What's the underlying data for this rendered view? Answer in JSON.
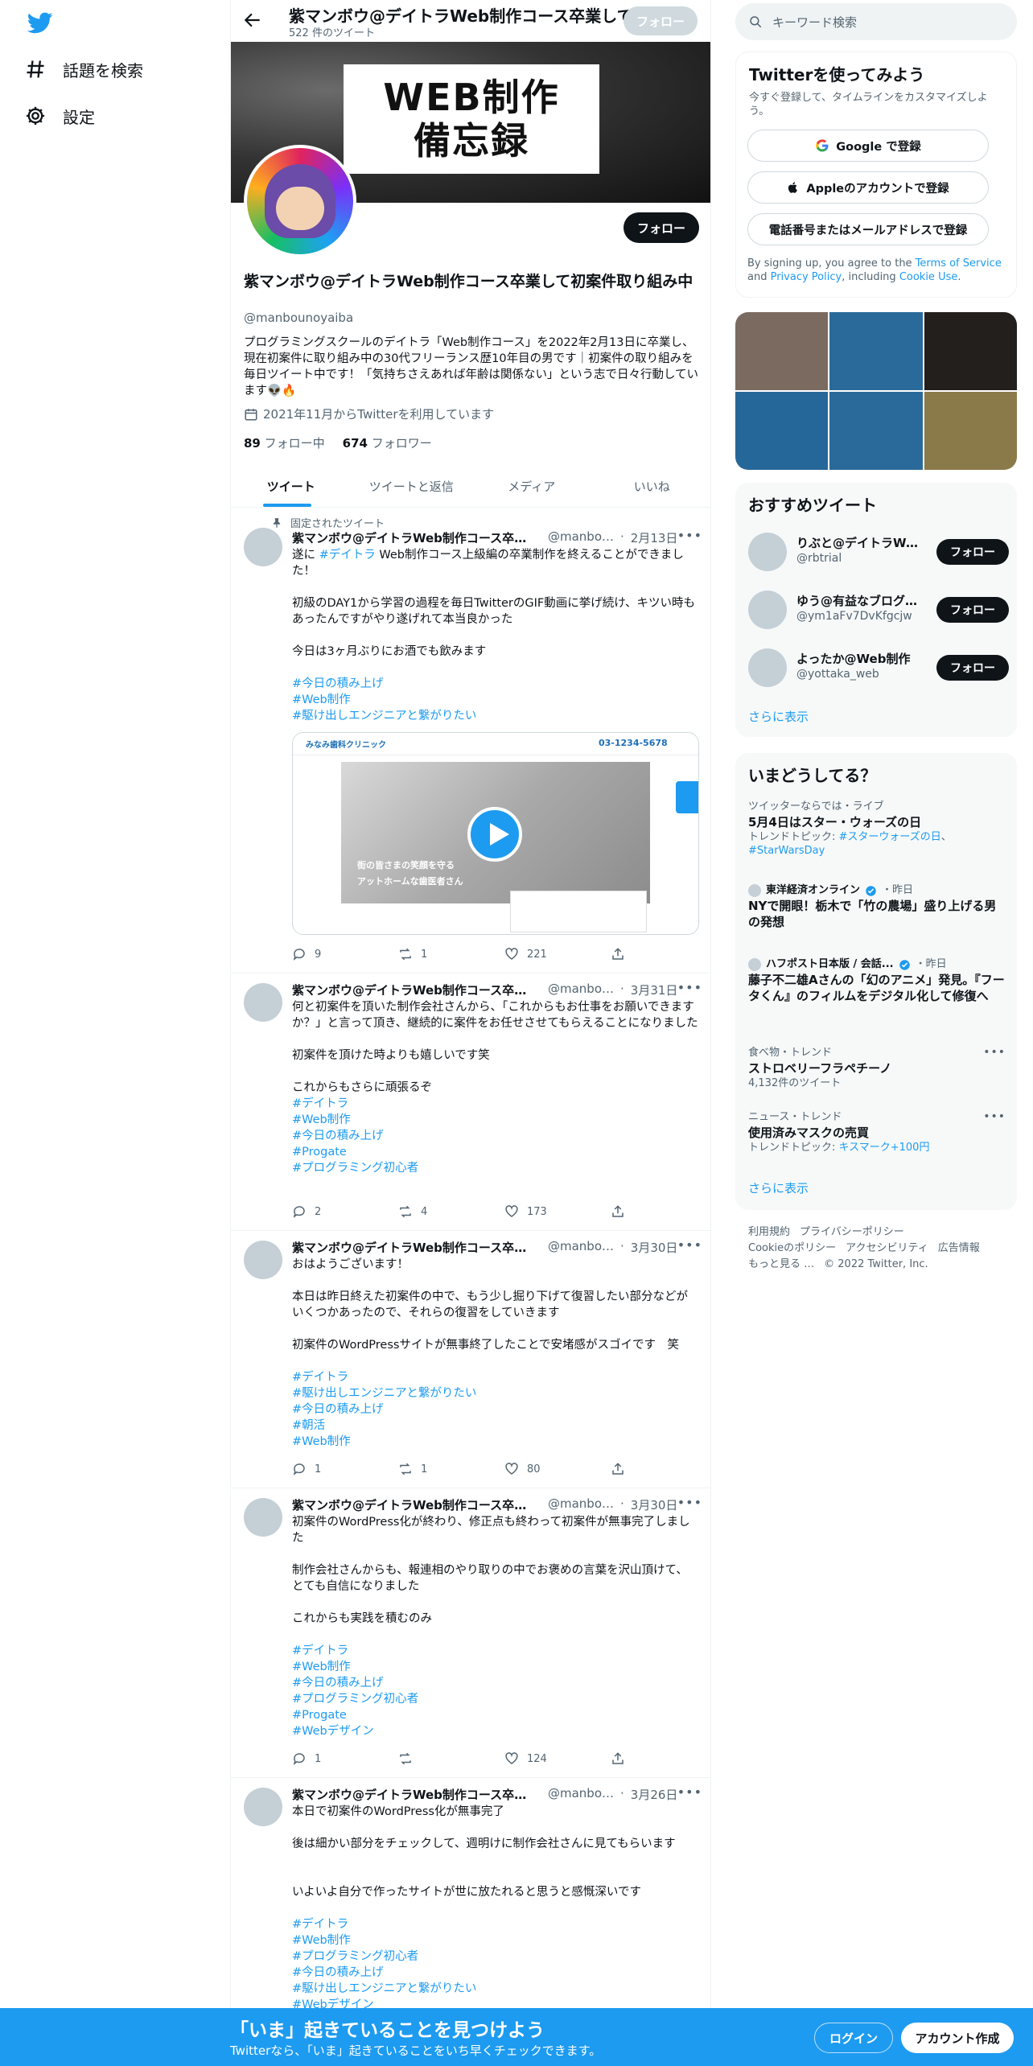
{
  "nav": {
    "explore_label": "話題を検索",
    "settings_label": "設定"
  },
  "topbar": {
    "name": "紫マンボウ@デイトラWeb制作コース卒業して",
    "tweet_count": "522 件のツイート",
    "follow_label": "フォロー"
  },
  "banner": {
    "line1": "WEB制作",
    "line2": "備忘録"
  },
  "profile": {
    "follow_label": "フォロー",
    "name": "紫マンボウ@デイトラWeb制作コース卒業して初案件取り組み中",
    "handle": "@manbounoyaiba",
    "bio": "プログラミングスクールのデイトラ「Web制作コース」を2022年2月13日に卒業し、現在初案件に取り組み中の30代フリーランス歴10年目の男です｜初案件の取り組みを毎日ツイート中です！「気持ちさえあれば年齢は関係ない」という志で日々行動しています👽🔥",
    "joined": "2021年11月からTwitterを利用しています",
    "following_count": "89",
    "following_label": "フォロー中",
    "followers_count": "674",
    "followers_label": "フォロワー"
  },
  "tabs": [
    {
      "label": "ツイート"
    },
    {
      "label": "ツイートと返信"
    },
    {
      "label": "メディア"
    },
    {
      "label": "いいね"
    }
  ],
  "tweets": [
    {
      "pinned_label": "固定されたツイート",
      "name": "紫マンボウ@デイトラWeb制作コース卒業して初案件取り組み中",
      "handle": "@manbounoyaiba",
      "date": "2月13日",
      "body_prefix": "遂に ",
      "body_tag": "#デイトラ",
      "body_rest": " Web制作コース上級編の卒業制作を終えることができました！\n\n初級のDAY1から学習の過程を毎日TwitterのGIF動画に挙げ続け、キツい時もあったんですがやり遂げれて本当良かった\n\n今日は3ヶ月ぶりにお酒でも飲みます\n\n",
      "tags": "#今日の積み上げ\n#Web制作\n#駆け出しエンジニアと繋がりたい",
      "media": {
        "site": "みなみ歯科クリニック",
        "phone": "03-1234-5678",
        "caption1": "街の皆さまの笑顔を守る",
        "caption2": "アットホームな歯医者さん"
      },
      "replies": "9",
      "retweets": "1",
      "likes": "221"
    },
    {
      "name": "紫マンボウ@デイトラWeb制作コース卒業して初案件取り組み中",
      "handle": "@manbounoyaiba",
      "date": "3月31日",
      "body": "何と初案件を頂いた制作会社さんから、「これからもお仕事をお願いできますか？」と言って頂き、継続的に案件をお任せさせてもらえることになりました\n\n初案件を頂けた時よりも嬉しいです笑\n\nこれからもさらに頑張るぞ",
      "tags": "#デイトラ\n#Web制作\n#今日の積み上げ\n#Progate\n#プログラミング初心者",
      "replies": "2",
      "retweets": "4",
      "likes": "173"
    },
    {
      "name": "紫マンボウ@デイトラWeb制作コース卒業して初案件取り組み中",
      "handle": "@manbounoyaiba",
      "date": "3月30日",
      "body": "おはようございます！\n\n本日は昨日終えた初案件の中で、もう少し掘り下げて復習したい部分などがいくつかあったので、それらの復習をしていきます\n\n初案件のWordPressサイトが無事終了したことで安堵感がスゴイです　笑\n",
      "tags": "#デイトラ\n#駆け出しエンジニアと繋がりたい\n#今日の積み上げ\n#朝活\n#Web制作",
      "replies": "1",
      "retweets": "1",
      "likes": "80"
    },
    {
      "name": "紫マンボウ@デイトラWeb制作コース卒業して初案件取り組み中",
      "handle": "@manbounoyaiba",
      "date": "3月30日",
      "body": "初案件のWordPress化が終わり、修正点も終わって初案件が無事完了しました\n\n制作会社さんからも、報連相のやり取りの中でお褒めの言葉を沢山頂けて、とても自信になりました\n\nこれからも実践を積むのみ\n",
      "tags": "#デイトラ\n#Web制作\n#今日の積み上げ\n#プログラミング初心者\n#Progate\n#Webデザイン",
      "replies": "1",
      "retweets": "",
      "likes": "124"
    },
    {
      "name": "紫マンボウ@デイトラWeb制作コース卒業して初案件取り組み中",
      "handle": "@manbounoyaiba",
      "date": "3月26日",
      "body": "本日で初案件のWordPress化が無事完了\n\n後は細かい部分をチェックして、週明けに制作会社さんに見てもらいます\n\n\nいよいよ自分で作ったサイトが世に放たれると思うと感慨深いです\n",
      "tags": "#デイトラ\n#Web制作\n#プログラミング初心者\n#今日の積み上げ\n#駆け出しエンジニアと繋がりたい\n#Webデザイン"
    }
  ],
  "search": {
    "placeholder": "キーワード検索"
  },
  "join": {
    "title": "Twitterを使ってみよう",
    "subtitle": "今すぐ登録して、タイムラインをカスタマイズしよう。",
    "google": "Google で登録",
    "apple": "Appleのアカウントで登録",
    "phone": "電話番号またはメールアドレスで登録",
    "legal_1": "By signing up, you agree to the ",
    "legal_tos": "Terms of Service",
    "legal_2": " and ",
    "legal_privacy": "Privacy Policy",
    "legal_3": ", including ",
    "legal_cookie": "Cookie Use",
    "legal_4": "."
  },
  "photo_colors": [
    "#7a6a5f",
    "#2a6a9a",
    "#221f1d",
    "#26679a",
    "#2a6a9a",
    "#8a7a4a"
  ],
  "recommend": {
    "title": "おすすめツイート",
    "items": [
      {
        "name": "りぶと@デイトラWeb制作",
        "handle": "@rbtrial",
        "follow": "フォロー"
      },
      {
        "name": "ゆう@有益なブログ発信者",
        "handle": "@ym1aFv7DvKfgcjw",
        "follow": "フォロー"
      },
      {
        "name": "よったか@Web制作",
        "handle": "@yottaka_web",
        "follow": "フォロー"
      }
    ],
    "show_more": "さらに表示"
  },
  "trends": {
    "title": "いまどうしてる？",
    "t1": {
      "ctx": "ツイッターならでは・ライブ",
      "title": "5月4日はスター・ウォーズの日",
      "sub_prefix": "トレンドトピック: ",
      "sub_tag1": "#スターウォーズの日",
      "sub_sep": "、",
      "sub_tag2": "#StarWarsDay"
    },
    "n1": {
      "source": "東洋経済オンライン",
      "time": "・昨日",
      "title": "NYで開眼！栃木で「竹の農場」盛り上げる男の発想"
    },
    "n2": {
      "source": "ハフポスト日本版 / 会話...",
      "time": "・昨日",
      "title": "藤子不二雄Aさんの「幻のアニメ」発見。『フータくん』のフィルムをデジタル化して修復へ"
    },
    "t2": {
      "ctx": "食べ物・トレンド",
      "title": "ストロベリーフラペチーノ",
      "sub": "4,132件のツイート"
    },
    "t3": {
      "ctx": "ニュース・トレンド",
      "title": "使用済みマスクの売買",
      "sub_prefix": "トレンドトピック: ",
      "sub_tag1": "キスマーク+100円"
    },
    "show_more": "さらに表示"
  },
  "footer": {
    "terms": "利用規約",
    "privacy": "プライバシーポリシー",
    "cookie": "Cookieのポリシー",
    "accessibility": "アクセシビリティ",
    "ads": "広告情報",
    "more": "もっと見る …",
    "copyright": "© 2022 Twitter, Inc."
  },
  "bottombar": {
    "title": "「いま」起きていることを見つけよう",
    "subtitle": "Twitterなら、「いま」起きていることをいち早くチェックできます。",
    "login": "ログイン",
    "signup": "アカウント作成"
  }
}
